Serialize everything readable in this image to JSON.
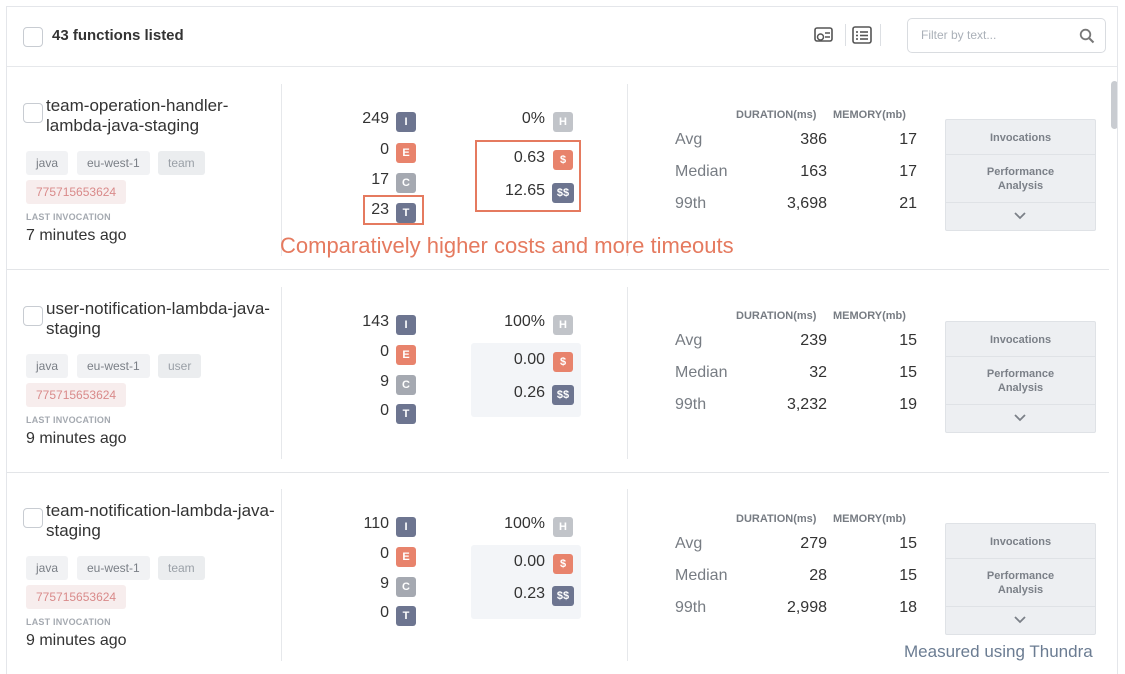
{
  "header": {
    "title": "43 functions listed",
    "filter_placeholder": "Filter by text..."
  },
  "functions": [
    {
      "name": "team-operation-handler-lambda-java-staging",
      "tags": [
        "java",
        "eu-west-1",
        "team"
      ],
      "account": "775715653624",
      "last_label": "LAST INVOCATION",
      "last_value": "7 minutes ago",
      "invocations": "249",
      "errors": "0",
      "cold_starts": "17",
      "timeouts": "23",
      "health": "0%",
      "cost": "0.63",
      "monthly_cost": "12.65",
      "metrics": {
        "duration_header": "DURATION(ms)",
        "memory_header": "MEMORY(mb)",
        "rows": [
          {
            "label": "Avg",
            "duration": "386",
            "memory": "17"
          },
          {
            "label": "Median",
            "duration": "163",
            "memory": "17"
          },
          {
            "label": "99th",
            "duration": "3,698",
            "memory": "21"
          }
        ]
      }
    },
    {
      "name": "user-notification-lambda-java-staging",
      "tags": [
        "java",
        "eu-west-1",
        "user"
      ],
      "account": "775715653624",
      "last_label": "LAST INVOCATION",
      "last_value": "9 minutes ago",
      "invocations": "143",
      "errors": "0",
      "cold_starts": "9",
      "timeouts": "0",
      "health": "100%",
      "cost": "0.00",
      "monthly_cost": "0.26",
      "metrics": {
        "duration_header": "DURATION(ms)",
        "memory_header": "MEMORY(mb)",
        "rows": [
          {
            "label": "Avg",
            "duration": "239",
            "memory": "15"
          },
          {
            "label": "Median",
            "duration": "32",
            "memory": "15"
          },
          {
            "label": "99th",
            "duration": "3,232",
            "memory": "19"
          }
        ]
      }
    },
    {
      "name": "team-notification-lambda-java-staging",
      "tags": [
        "java",
        "eu-west-1",
        "team"
      ],
      "account": "775715653624",
      "last_label": "LAST INVOCATION",
      "last_value": "9 minutes ago",
      "invocations": "110",
      "errors": "0",
      "cold_starts": "9",
      "timeouts": "0",
      "health": "100%",
      "cost": "0.00",
      "monthly_cost": "0.23",
      "metrics": {
        "duration_header": "DURATION(ms)",
        "memory_header": "MEMORY(mb)",
        "rows": [
          {
            "label": "Avg",
            "duration": "279",
            "memory": "15"
          },
          {
            "label": "Median",
            "duration": "28",
            "memory": "15"
          },
          {
            "label": "99th",
            "duration": "2,998",
            "memory": "18"
          }
        ]
      }
    }
  ],
  "badges": {
    "invocations": "I",
    "errors": "E",
    "cold_starts": "C",
    "timeouts": "T",
    "health": "H",
    "cost": "$",
    "monthly_cost": "$$"
  },
  "actions": {
    "invocations": "Invocations",
    "performance": "Performance Analysis"
  },
  "annotation": "Comparatively higher costs and more timeouts",
  "footer_note": "Measured using Thundra",
  "colors": {
    "highlight": "#e57a5f",
    "badge_dark": "#6d7590",
    "badge_error": "#e8836c"
  }
}
